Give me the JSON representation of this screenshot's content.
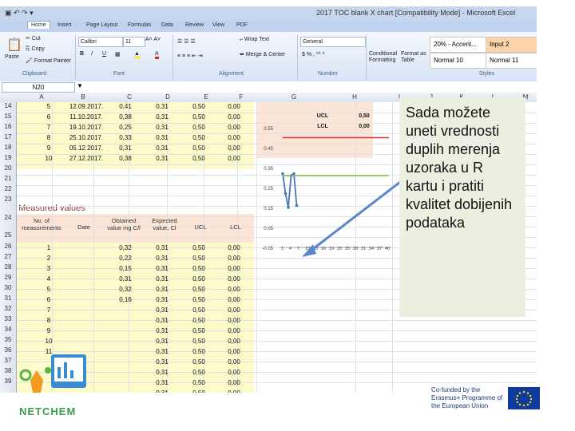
{
  "window": {
    "title": "2017 TOC blank X chart [Compatibility Mode] - Microsoft Excel"
  },
  "tabs": [
    "Home",
    "Insert",
    "Page Layout",
    "Formulas",
    "Data",
    "Review",
    "View",
    "PDF"
  ],
  "clipboard": {
    "paste": "Paste",
    "cut": "Cut",
    "copy": "Copy",
    "format_painter": "Format Painter",
    "group": "Clipboard"
  },
  "font": {
    "name": "Calibri",
    "size": "11",
    "group": "Font"
  },
  "alignment": {
    "wrap": "Wrap Text",
    "merge": "Merge & Center",
    "group": "Alignment"
  },
  "number": {
    "format": "General",
    "group": "Number"
  },
  "styles": {
    "conditional": "Conditional Formatting",
    "format_table": "Format as Table",
    "group": "Styles",
    "cells": [
      "20% - Accent...",
      "Input 2",
      "Normal 10",
      "Normal 11"
    ]
  },
  "namebox": "N20",
  "columns": [
    "A",
    "B",
    "C",
    "D",
    "E",
    "F",
    "G",
    "H",
    "I",
    "J",
    "K",
    "L",
    "M"
  ],
  "rows": {
    "top": [
      "14",
      "15",
      "16",
      "17",
      "18",
      "19",
      "20",
      "21",
      "22",
      "23",
      "24",
      "25",
      "26",
      "27",
      "28",
      "29",
      "30",
      "31",
      "32",
      "33",
      "34",
      "35",
      "36",
      "37",
      "38",
      "39"
    ]
  },
  "top_table": [
    [
      "5",
      "12.09.2017.",
      "0,41",
      "0,31",
      "0,50",
      "0,00"
    ],
    [
      "6",
      "11.10.2017.",
      "0,38",
      "0,31",
      "0,50",
      "0,00"
    ],
    [
      "7",
      "19.10.2017.",
      "0,25",
      "0,31",
      "0,50",
      "0,00"
    ],
    [
      "8",
      "25.10.2017.",
      "0,33",
      "0,31",
      "0,50",
      "0,00"
    ],
    [
      "9",
      "05.12.2017.",
      "0,31",
      "0,31",
      "0,50",
      "0,00"
    ],
    [
      "10",
      "27.12.2017.",
      "0,38",
      "0,31",
      "0,50",
      "0,00"
    ]
  ],
  "limits": [
    {
      "label": "UCL",
      "value": "0,50"
    },
    {
      "label": "LCL",
      "value": "0,00"
    }
  ],
  "measured_title": "Measured values",
  "measured_headers": [
    "No. of measurements",
    "Date",
    "Obtained value mg C/l",
    "Expected value, Cl",
    "UCL",
    "LCL"
  ],
  "measured_rows": [
    [
      "1",
      "",
      "0,32",
      "0,31",
      "0,50",
      "0,00"
    ],
    [
      "2",
      "",
      "0,22",
      "0,31",
      "0,50",
      "0,00"
    ],
    [
      "3",
      "",
      "0,15",
      "0,31",
      "0,50",
      "0,00"
    ],
    [
      "4",
      "",
      "0,31",
      "0,31",
      "0,50",
      "0,00"
    ],
    [
      "5",
      "",
      "0,32",
      "0,31",
      "0,50",
      "0,00"
    ],
    [
      "6",
      "",
      "0,16",
      "0,31",
      "0,50",
      "0,00"
    ],
    [
      "7",
      "",
      "",
      "0,31",
      "0,50",
      "0,00"
    ],
    [
      "8",
      "",
      "",
      "0,31",
      "0,50",
      "0,00"
    ],
    [
      "9",
      "",
      "",
      "0,31",
      "0,50",
      "0,00"
    ],
    [
      "10",
      "",
      "",
      "0,31",
      "0,50",
      "0,00"
    ],
    [
      "11",
      "",
      "",
      "0,31",
      "0,50",
      "0,00"
    ],
    [
      "",
      "",
      "",
      "0,31",
      "0,50",
      "0,00"
    ],
    [
      "",
      "",
      "",
      "0,31",
      "0,50",
      "0,00"
    ],
    [
      "",
      "",
      "",
      "0,31",
      "0,50",
      "0,00"
    ],
    [
      "",
      "",
      "",
      "0,31",
      "0,50",
      "0,00"
    ]
  ],
  "chart_data": {
    "type": "line",
    "yticks": [
      "0.55",
      "0.45",
      "0.35",
      "0.25",
      "0.15",
      "0.05",
      "-0.05"
    ],
    "xticks": [
      "1",
      "4",
      "7",
      "10",
      "13",
      "16",
      "19",
      "22",
      "25",
      "28",
      "31",
      "34",
      "37",
      "40"
    ],
    "ylim": [
      -0.05,
      0.55
    ],
    "series": [
      {
        "values": [
          0.32,
          0.22,
          0.15,
          0.31,
          0.32,
          0.16
        ],
        "color": "#4a76b8"
      },
      {
        "values": [
          0.5,
          0.5,
          0.5,
          0.5,
          0.5,
          0.5,
          0.5,
          0.5,
          0.5,
          0.5,
          0.5,
          0.5,
          0.5,
          0.5,
          0.5,
          0.5,
          0.5,
          0.5,
          0.5,
          0.5
        ],
        "color": "#d9322f"
      },
      {
        "values": [
          0.31,
          0.31,
          0.31,
          0.31,
          0.31,
          0.31,
          0.31,
          0.31,
          0.31,
          0.31,
          0.31,
          0.31,
          0.31,
          0.31,
          0.31,
          0.31,
          0.31,
          0.31,
          0.31,
          0.31
        ],
        "color": "#7cbf41"
      }
    ]
  },
  "callout": "Sada možete uneti vrednosti duplih merenja uzoraka u R kartu i pratiti kvalitet dobijenih podataka",
  "footer": {
    "left_logo": "NETCHEM",
    "right_text": "Co-funded by the Erasmus+ Programme of the European Union"
  }
}
